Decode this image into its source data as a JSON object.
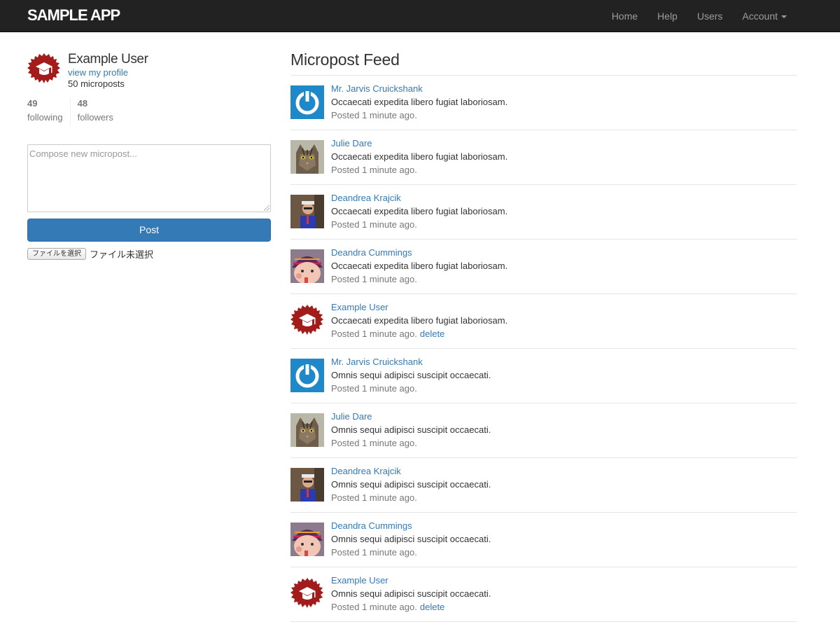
{
  "brand": "SAMPLE APP",
  "nav": {
    "home": "Home",
    "help": "Help",
    "users": "Users",
    "account": "Account"
  },
  "user": {
    "name": "Example User",
    "profile_link": "view my profile",
    "micropost_count": "50 microposts",
    "following_count": "49",
    "following_label": "following",
    "followers_count": "48",
    "followers_label": "followers"
  },
  "compose": {
    "placeholder": "Compose new micropost...",
    "post_label": "Post",
    "file_button": "ファイルを選択",
    "file_status": "ファイル未選択"
  },
  "feed": {
    "title": "Micropost Feed",
    "items": [
      {
        "user": "Mr. Jarvis Cruickshank",
        "avatar": "power-icon",
        "content": "Occaecati expedita libero fugiat laboriosam.",
        "time": "Posted 1 minute ago.",
        "delete": ""
      },
      {
        "user": "Julie Dare",
        "avatar": "cat-photo",
        "content": "Occaecati expedita libero fugiat laboriosam.",
        "time": "Posted 1 minute ago.",
        "delete": ""
      },
      {
        "user": "Deandrea Krajcik",
        "avatar": "person-photo",
        "content": "Occaecati expedita libero fugiat laboriosam.",
        "time": "Posted 1 minute ago.",
        "delete": ""
      },
      {
        "user": "Deandra Cummings",
        "avatar": "child-photo",
        "content": "Occaecati expedita libero fugiat laboriosam.",
        "time": "Posted 1 minute ago.",
        "delete": ""
      },
      {
        "user": "Example User",
        "avatar": "graduation-badge-icon",
        "content": "Occaecati expedita libero fugiat laboriosam.",
        "time": "Posted 1 minute ago.",
        "delete": "delete"
      },
      {
        "user": "Mr. Jarvis Cruickshank",
        "avatar": "power-icon",
        "content": "Omnis sequi adipisci suscipit occaecati.",
        "time": "Posted 1 minute ago.",
        "delete": ""
      },
      {
        "user": "Julie Dare",
        "avatar": "cat-photo",
        "content": "Omnis sequi adipisci suscipit occaecati.",
        "time": "Posted 1 minute ago.",
        "delete": ""
      },
      {
        "user": "Deandrea Krajcik",
        "avatar": "person-photo",
        "content": "Omnis sequi adipisci suscipit occaecati.",
        "time": "Posted 1 minute ago.",
        "delete": ""
      },
      {
        "user": "Deandra Cummings",
        "avatar": "child-photo",
        "content": "Omnis sequi adipisci suscipit occaecati.",
        "time": "Posted 1 minute ago.",
        "delete": ""
      },
      {
        "user": "Example User",
        "avatar": "graduation-badge-icon",
        "content": "Omnis sequi adipisci suscipit occaecati.",
        "time": "Posted 1 minute ago.",
        "delete": "delete"
      }
    ]
  },
  "colors": {
    "navbar": "#222222",
    "link": "#337ab7",
    "button": "#337ab7",
    "badge": "#a31c1c"
  }
}
